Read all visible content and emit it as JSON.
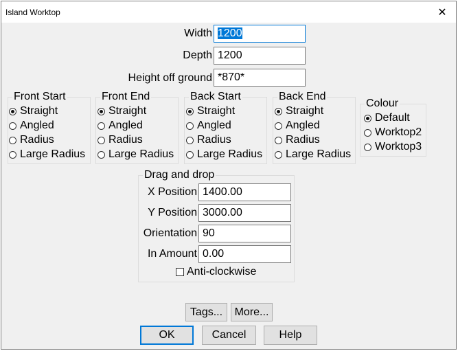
{
  "window": {
    "title": "Island Worktop",
    "close_glyph": "✕"
  },
  "fields": {
    "width": {
      "label": "Width",
      "value": "1200"
    },
    "depth": {
      "label": "Depth",
      "value": "1200"
    },
    "height": {
      "label": "Height off ground",
      "value": "*870*"
    }
  },
  "groups": {
    "front_start": {
      "title": "Front Start",
      "options": [
        "Straight",
        "Angled",
        "Radius",
        "Large Radius"
      ],
      "selected": "Straight"
    },
    "front_end": {
      "title": "Front End",
      "options": [
        "Straight",
        "Angled",
        "Radius",
        "Large Radius"
      ],
      "selected": "Straight"
    },
    "back_start": {
      "title": "Back Start",
      "options": [
        "Straight",
        "Angled",
        "Radius",
        "Large Radius"
      ],
      "selected": "Straight"
    },
    "back_end": {
      "title": "Back End",
      "options": [
        "Straight",
        "Angled",
        "Radius",
        "Large Radius"
      ],
      "selected": "Straight"
    },
    "colour": {
      "title": "Colour",
      "options": [
        "Default",
        "Worktop2",
        "Worktop3"
      ],
      "selected": "Default"
    }
  },
  "drag_drop": {
    "title": "Drag and drop",
    "x": {
      "label": "X Position",
      "value": "1400.00"
    },
    "y": {
      "label": "Y Position",
      "value": "3000.00"
    },
    "orientation": {
      "label": "Orientation",
      "value": "90"
    },
    "in_amount": {
      "label": "In Amount",
      "value": "0.00"
    },
    "anticlockwise": {
      "label": "Anti-clockwise",
      "checked": false
    }
  },
  "buttons": {
    "tags": "Tags...",
    "more": "More...",
    "ok": "OK",
    "cancel": "Cancel",
    "help": "Help"
  },
  "colors": {
    "accent": "#0078d7",
    "dialog_bg": "#f0f0f0"
  },
  "icons": {
    "close": "close-icon",
    "radio": "radio-button",
    "checkbox": "checkbox"
  }
}
